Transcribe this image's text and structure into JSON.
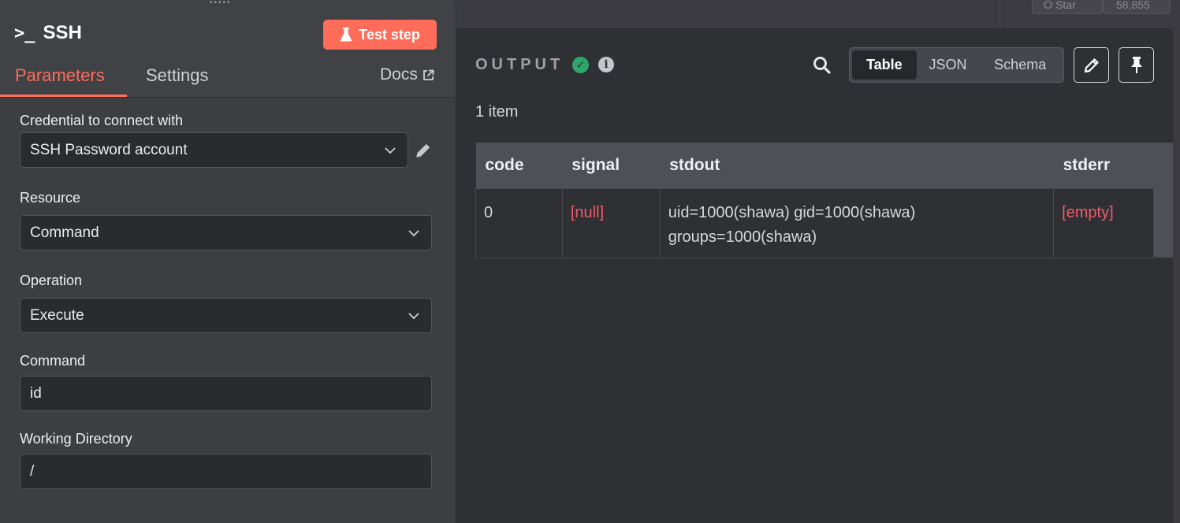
{
  "topbar": {
    "star_label": "Star",
    "star_count": "58,855"
  },
  "node": {
    "title": "SSH",
    "icon": "terminal-icon",
    "test_button": "Test step",
    "tabs": [
      {
        "label": "Parameters",
        "active": true
      },
      {
        "label": "Settings",
        "active": false
      }
    ],
    "docs_label": "Docs"
  },
  "form": {
    "credential": {
      "label": "Credential to connect with",
      "value": "SSH Password account"
    },
    "resource": {
      "label": "Resource",
      "value": "Command"
    },
    "operation": {
      "label": "Operation",
      "value": "Execute"
    },
    "command": {
      "label": "Command",
      "value": "id"
    },
    "working_directory": {
      "label": "Working Directory",
      "value": "/"
    }
  },
  "output": {
    "title": "OUTPUT",
    "view_options": [
      {
        "label": "Table",
        "active": true
      },
      {
        "label": "JSON",
        "active": false
      },
      {
        "label": "Schema",
        "active": false
      }
    ],
    "item_count": "1 item",
    "columns": [
      "code",
      "signal",
      "stdout",
      "stderr"
    ],
    "rows": [
      {
        "code": "0",
        "signal": "[null]",
        "stdout_line1": "uid=1000(shawa) gid=1000(shawa)",
        "stdout_line2": "groups=1000(shawa)",
        "stderr": "[empty]"
      }
    ]
  },
  "colors": {
    "accent": "#ff6d5a",
    "success": "#2ea56a",
    "null_text": "#f05b6a"
  }
}
